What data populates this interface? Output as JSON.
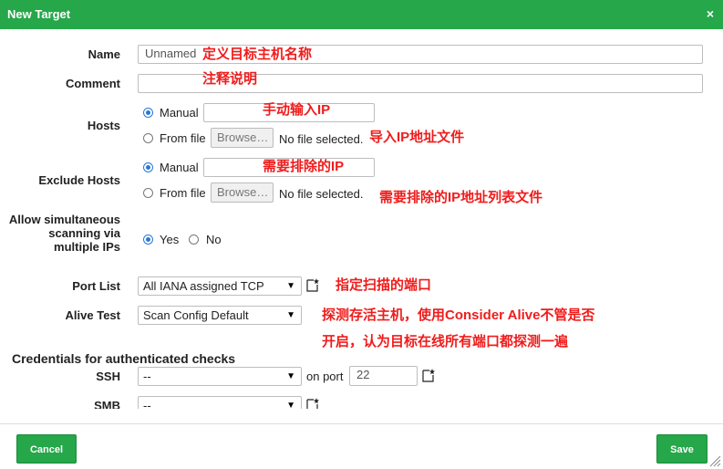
{
  "dialog": {
    "title": "New Target",
    "close_symbol": "×"
  },
  "fields": {
    "name": {
      "label": "Name",
      "value": "Unnamed"
    },
    "comment": {
      "label": "Comment",
      "value": ""
    },
    "hosts": {
      "label": "Hosts",
      "manual": "Manual",
      "from_file": "From file",
      "selected": "Manual",
      "manual_value": ""
    },
    "exclude_hosts": {
      "label": "Exclude Hosts",
      "manual": "Manual",
      "from_file": "From file",
      "selected": "Manual",
      "manual_value": ""
    },
    "browse_label": "Browse…",
    "no_file": "No file selected.",
    "allow_simultaneous": {
      "label": "Allow simultaneous scanning via multiple IPs",
      "yes": "Yes",
      "no": "No",
      "selected": "Yes"
    },
    "port_list": {
      "label": "Port List",
      "value": "All IANA assigned TCP"
    },
    "alive_test": {
      "label": "Alive Test",
      "value": "Scan Config Default"
    },
    "credentials_heading": "Credentials for authenticated checks",
    "ssh": {
      "label": "SSH",
      "value": "--",
      "on_port_label": "on port",
      "port": "22"
    },
    "smb": {
      "label": "SMB",
      "value": "--"
    }
  },
  "annotations": {
    "name": "定义目标主机名称",
    "comment": "注释说明",
    "hosts_manual": "手动输入IP",
    "hosts_file": "导入IP地址文件",
    "exclude_manual": "需要排除的IP",
    "exclude_file": "需要排除的IP地址列表文件",
    "port_list": "指定扫描的端口",
    "alive_line1": "探测存活主机，使用Consider Alive不管是否",
    "alive_line2": "开启，认为目标在线所有端口都探测一遍"
  },
  "footer": {
    "cancel": "Cancel",
    "save": "Save"
  },
  "icons": {
    "new": "new-icon",
    "close": "close-icon",
    "dropdown": "chevron-down-icon",
    "resize": "resize-grip-icon"
  },
  "colors": {
    "primary": "#25a74a",
    "annotation": "#f01c1c",
    "radio_selected": "#2a77d6"
  }
}
